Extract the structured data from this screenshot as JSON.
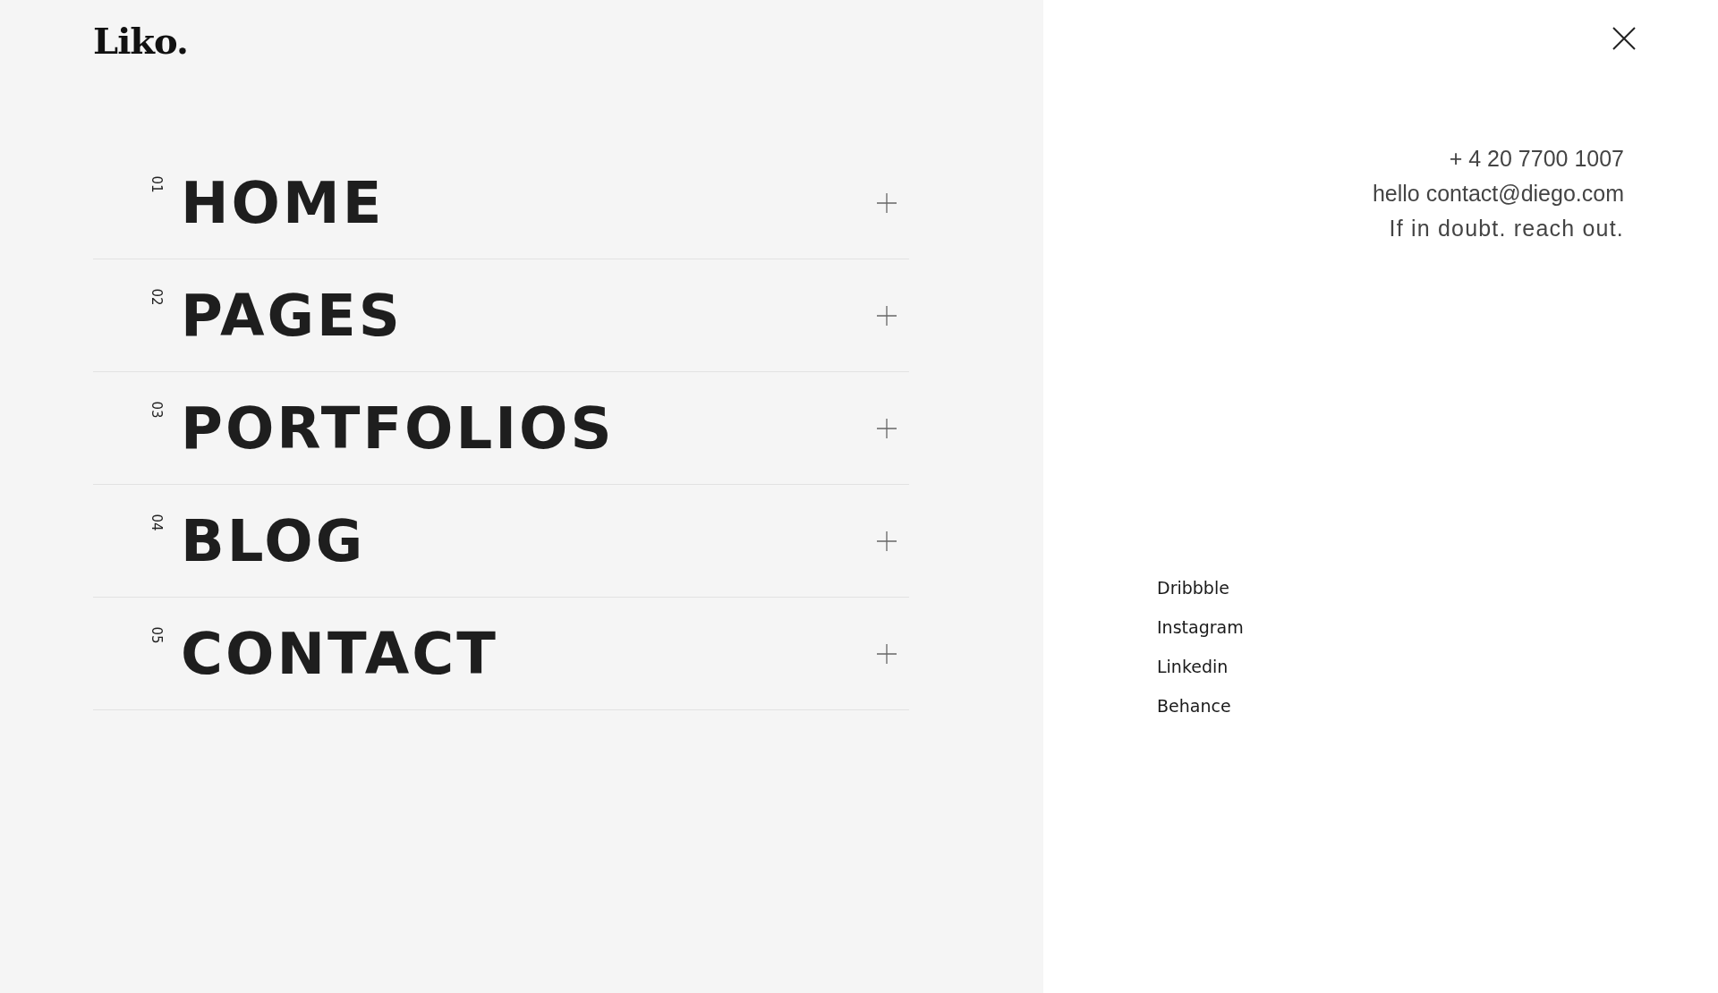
{
  "logo": "Liko.",
  "menu": [
    {
      "number": "01",
      "label": "HOME"
    },
    {
      "number": "02",
      "label": "PAGES"
    },
    {
      "number": "03",
      "label": "PORTFOLIOS"
    },
    {
      "number": "04",
      "label": "BLOG"
    },
    {
      "number": "05",
      "label": "CONTACT"
    }
  ],
  "contact": [
    "+ 4 20 7700 1007",
    "hello contact@diego.com",
    "If in doubt. reach out."
  ],
  "social": [
    "Dribbble",
    "Instagram",
    "Linkedin",
    "Behance"
  ]
}
